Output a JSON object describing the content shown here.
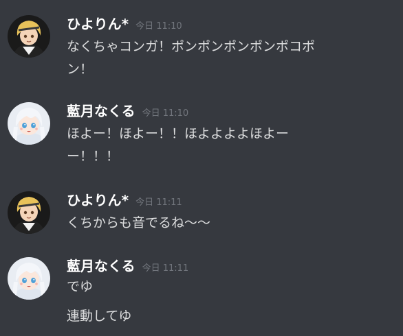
{
  "messages": [
    {
      "username": "ひよりん*",
      "timestamp": "今日 11:10",
      "avatar_icon": "blonde-anime-avatar-icon",
      "lines": [
        "なくちゃコンガ！ポンポンポンポンポコポ",
        "ン！"
      ]
    },
    {
      "username": "藍月なくる",
      "timestamp": "今日 11:10",
      "avatar_icon": "white-haired-anime-avatar-icon",
      "lines": [
        "ほよー！ほよー！！ほよよよよほよー",
        "ー！！！"
      ]
    },
    {
      "username": "ひよりん*",
      "timestamp": "今日 11:11",
      "avatar_icon": "blonde-anime-avatar-icon",
      "lines": [
        "くちからも音でるね〜〜"
      ]
    },
    {
      "username": "藍月なくる",
      "timestamp": "今日 11:11",
      "avatar_icon": "white-haired-anime-avatar-icon",
      "lines": [
        "でゆ",
        "連動してゆ"
      ]
    }
  ]
}
